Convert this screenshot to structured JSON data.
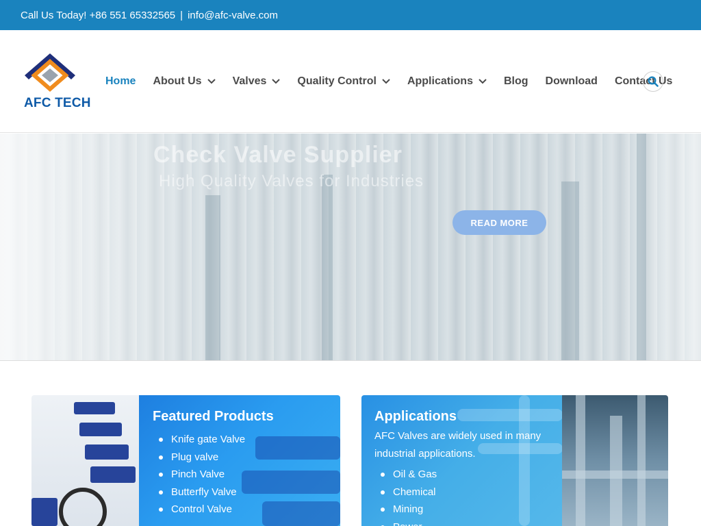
{
  "topbar": {
    "phone": "Call Us Today! +86 551 65332565",
    "separator": "|",
    "email": "info@afc-valve.com"
  },
  "logo": {
    "text": "AFC TECH"
  },
  "nav": {
    "items": [
      {
        "label": "Home",
        "dropdown": false,
        "active": true
      },
      {
        "label": "About Us",
        "dropdown": true
      },
      {
        "label": "Valves",
        "dropdown": true
      },
      {
        "label": "Quality Control",
        "dropdown": true
      },
      {
        "label": "Applications",
        "dropdown": true
      },
      {
        "label": "Blog",
        "dropdown": false
      },
      {
        "label": "Download",
        "dropdown": false
      },
      {
        "label": "Contact Us",
        "dropdown": false
      }
    ],
    "search_icon": "search-icon"
  },
  "hero": {
    "title": "Check Valve Supplier",
    "subtitle": "High Quality Valves for Industries",
    "button": "READ MORE"
  },
  "featured": {
    "title": "Featured Products",
    "items": [
      "Knife gate Valve",
      "Plug valve",
      "Pinch Valve",
      "Butterfly Valve",
      "Control Valve"
    ]
  },
  "applications": {
    "title": "Applications",
    "text": "AFC Valves are widely used in many industrial applications.",
    "items": [
      "Oil & Gas",
      "Chemical",
      "Mining",
      "Power"
    ]
  },
  "colors": {
    "topbar": "#1a83be",
    "accent": "#1a83be",
    "button": "#8cb4e8",
    "logo_blue": "#0e5aa7"
  }
}
